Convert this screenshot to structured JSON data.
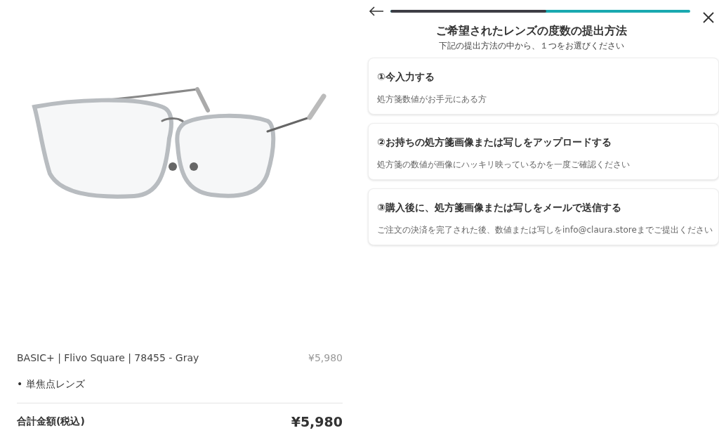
{
  "product": {
    "name": "BASIC+ | Flivo Square | 78455 - Gray",
    "price": "¥5,980",
    "options": [
      "• 単焦点レンズ"
    ],
    "total_label": "合計金額(税込)",
    "total": "¥5,980"
  },
  "progress": {
    "level": 0.52
  },
  "header": {
    "title": "ご希望されたレンズの度数の提出方法",
    "subtitle": "下記の提出方法の中から、１つをお選びください"
  },
  "options": [
    {
      "title": "①今入力する",
      "description": "処方箋数値がお手元にある方"
    },
    {
      "title": "②お持ちの処方箋画像または写しをアップロードする",
      "description": "処方箋の数値が画像にハッキリ映っているかを一度ご確認ください"
    },
    {
      "title": "③購入後に、処方箋画像または写しをメールで送信する",
      "description": "ご注文の決済を完了された後、数値または写しをinfo@claura.storeまでご提出ください"
    }
  ]
}
